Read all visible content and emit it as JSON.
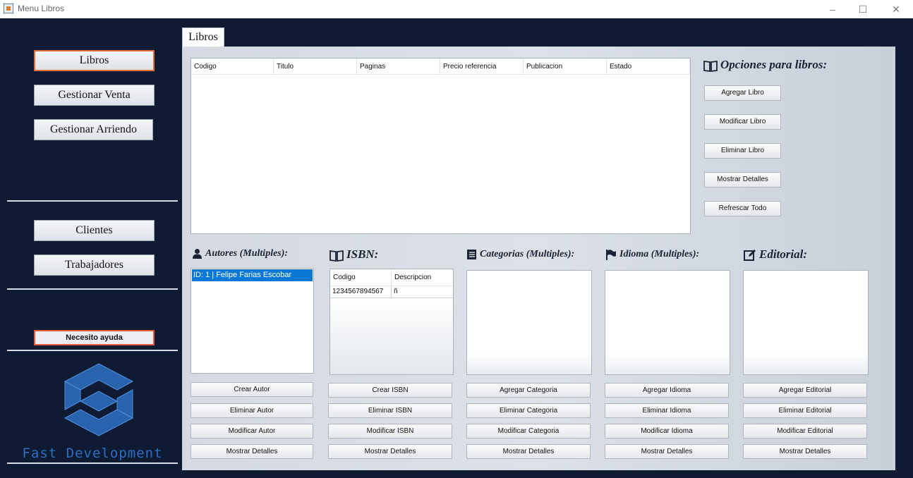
{
  "window": {
    "title": "Menu Libros",
    "controls": {
      "minimize": "–",
      "maximize": "☐",
      "close": "✕"
    }
  },
  "sidebar": {
    "primary": [
      "Libros",
      "Gestionar Venta",
      "Gestionar Arriendo"
    ],
    "secondary": [
      "Clientes",
      "Trabajadores"
    ],
    "help": "Necesito ayuda",
    "brand": "Fast Development",
    "active_item": "Libros"
  },
  "tab": {
    "label": "Libros"
  },
  "books_table": {
    "columns": [
      "Codigo",
      "Titulo",
      "Paginas",
      "Precio referencia",
      "Publicacion",
      "Estado"
    ],
    "rows": []
  },
  "options": {
    "title": "Opciones para libros:",
    "icon": "book-icon",
    "buttons": [
      "Agregar Libro",
      "Modificar Libro",
      "Eliminar Libro",
      "Mostrar Detalles",
      "Refrescar Todo"
    ]
  },
  "sections": {
    "autores": {
      "title": "Autores (Multiples):",
      "icon": "user-icon",
      "items": [
        "ID: 1  |  Felipe Farias Escobar"
      ],
      "buttons": [
        "Crear Autor",
        "Eliminar Autor",
        "Modificar Autor",
        "Mostrar Detalles"
      ]
    },
    "isbn": {
      "title": "ISBN:",
      "icon": "book-icon",
      "columns": [
        "Codigo",
        "Descripcion"
      ],
      "rows": [
        [
          "1234567894567",
          "ñ"
        ]
      ],
      "buttons": [
        "Crear ISBN",
        "Eliminar ISBN",
        "Modificar ISBN",
        "Mostrar Detalles"
      ]
    },
    "categorias": {
      "title": "Categorias (Multiples):",
      "icon": "list-icon",
      "items": [],
      "buttons": [
        "Agregar Categoria",
        "Eliminar Categoria",
        "Modificar Categoria",
        "Mostrar Detalles"
      ]
    },
    "idioma": {
      "title": "Idioma (Multiples):",
      "icon": "flag-icon",
      "items": [],
      "buttons": [
        "Agregar Idioma",
        "Eliminar Idioma",
        "Modificar Idioma",
        "Mostrar Detalles"
      ]
    },
    "editorial": {
      "title": "Editorial:",
      "icon": "edit-icon",
      "items": [],
      "buttons": [
        "Agregar Editorial",
        "Eliminar Editorial",
        "Modificar Editorial",
        "Mostrar Detalles"
      ]
    }
  },
  "colors": {
    "background": "#0f1a33",
    "selection": "#0a78d7",
    "active_border": "#e06d3a",
    "brand": "#2d6fc4"
  }
}
